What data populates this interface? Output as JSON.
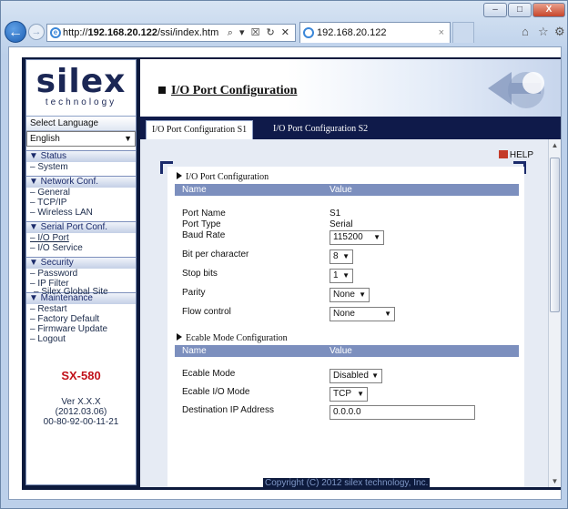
{
  "browser": {
    "url_prefix": "http://",
    "url_domain": "192.168.20.122",
    "url_path": "/ssi/index.htm",
    "url_controls": "⌕ ▾ ☒ ↻ ✕",
    "tab_title": "192.168.20.122",
    "tab_close": "×",
    "window_buttons": [
      "–",
      "□",
      "X"
    ],
    "right_icons": [
      "⌂",
      "☆",
      "⚙"
    ]
  },
  "sidebar": {
    "logo_brand": "silex",
    "logo_sub": "technology",
    "language_label": "Select Language",
    "language_value": "English",
    "sections": [
      {
        "heading": "▼ Status",
        "items": [
          "– System"
        ]
      },
      {
        "heading": "▼ Network Conf.",
        "items": [
          "– General",
          "– TCP/IP",
          "– Wireless LAN"
        ]
      },
      {
        "heading": "▼ Serial Port Conf.",
        "items": [
          "– I/O Port",
          "– I/O Service"
        ]
      },
      {
        "heading": "▼ Security",
        "items": [
          "– Password",
          "– IP Filter"
        ]
      },
      {
        "heading": "▼ Maintenance",
        "items": [
          "– Restart",
          "– Factory Default",
          "– Firmware Update",
          "– Logout"
        ]
      }
    ],
    "global_site": "–  Silex Global Site",
    "model": "SX-580",
    "version_lines": [
      "Ver X.X.X",
      "(2012.03.06)",
      "00-80-92-00-11-21"
    ]
  },
  "main": {
    "title": "I/O Port Configuration",
    "tabs": [
      "I/O Port Configuration S1",
      "I/O Port Configuration S2"
    ],
    "help": "HELP",
    "section1": {
      "title": "I/O Port Configuration",
      "col_name": "Name",
      "col_value": "Value",
      "port_name_label": "Port Name",
      "port_name_value": "S1",
      "port_type_label": "Port Type",
      "port_type_value": "Serial",
      "baud_label": "Baud Rate",
      "baud_value": "115200",
      "bits_label": "Bit per character",
      "bits_value": "8",
      "stop_label": "Stop bits",
      "stop_value": "1",
      "parity_label": "Parity",
      "parity_value": "None",
      "flow_label": "Flow control",
      "flow_value": "None"
    },
    "section2": {
      "title": "Ecable Mode Configuration",
      "col_name": "Name",
      "col_value": "Value",
      "mode_label": "Ecable Mode",
      "mode_value": "Disabled",
      "io_label": "Ecable I/O Mode",
      "io_value": "TCP",
      "dest_label": "Destination IP Address",
      "dest_value": "0.0.0.0"
    },
    "copyright": "Copyright (C) 2012 silex technology, Inc."
  }
}
